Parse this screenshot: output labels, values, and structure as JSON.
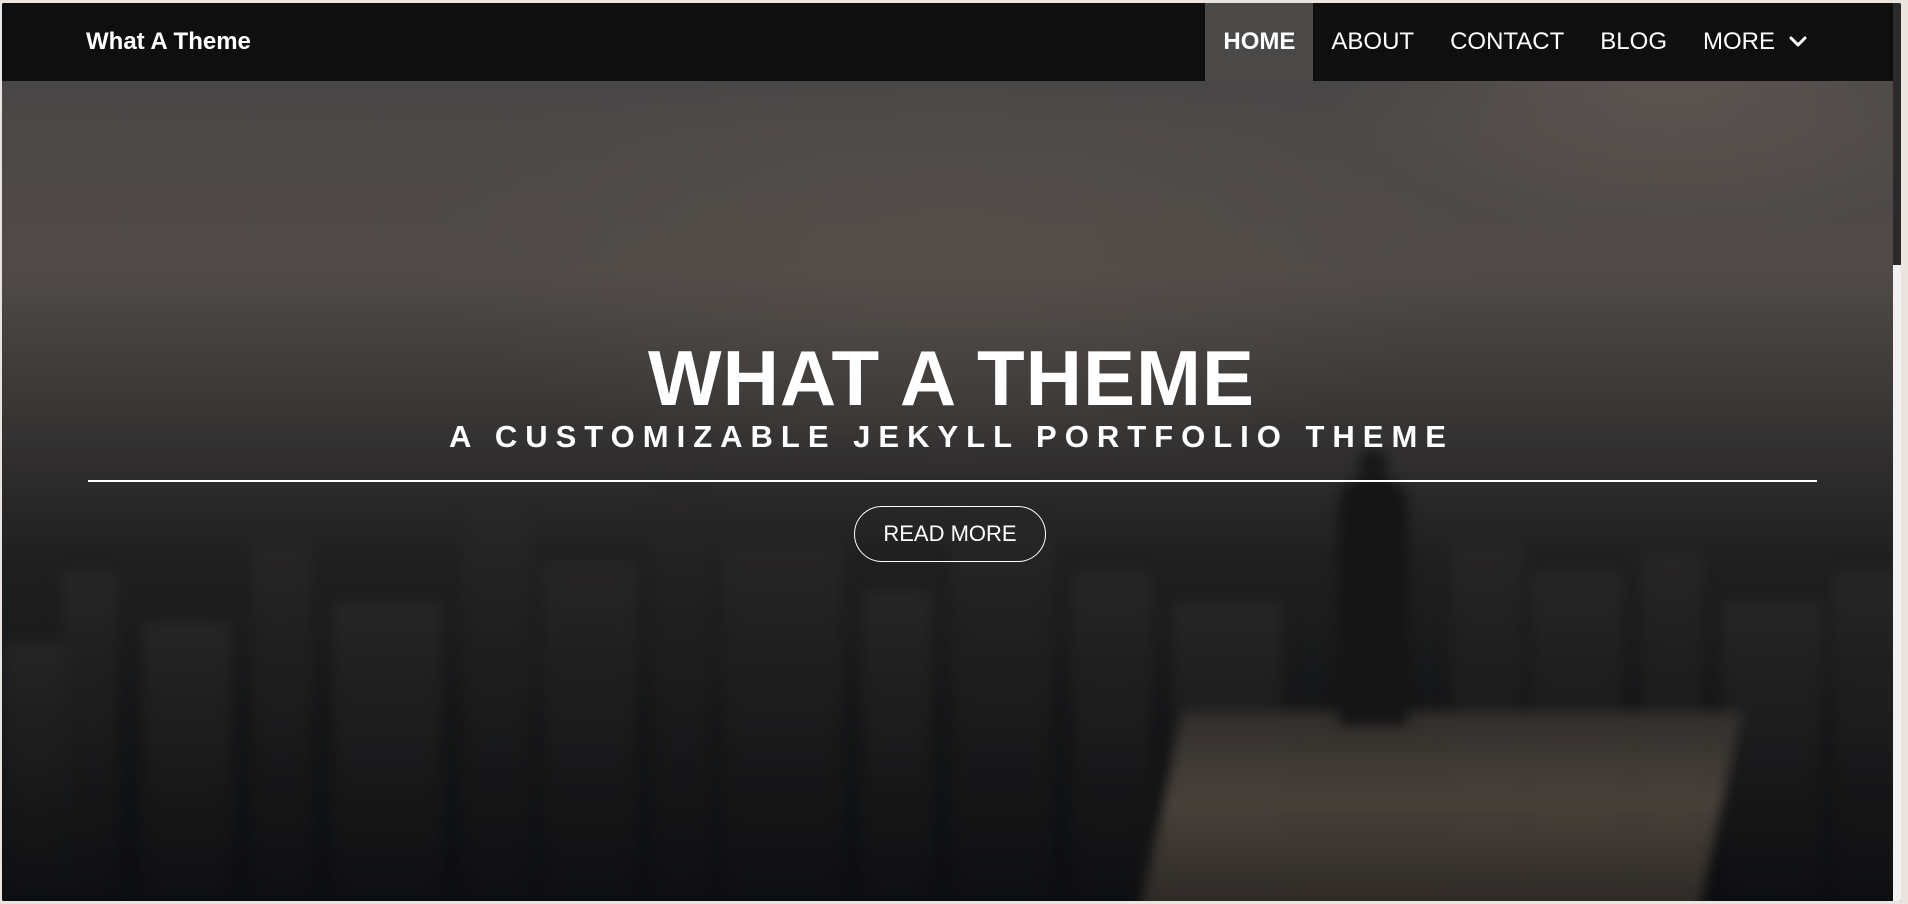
{
  "navbar": {
    "brand": "What A Theme",
    "items": [
      {
        "label": "HOME",
        "active": true
      },
      {
        "label": "ABOUT",
        "active": false
      },
      {
        "label": "CONTACT",
        "active": false
      },
      {
        "label": "BLOG",
        "active": false
      },
      {
        "label": "MORE",
        "active": false,
        "icon": "chevron-down-icon"
      }
    ]
  },
  "hero": {
    "title": "WHAT A THEME",
    "subtitle": "A CUSTOMIZABLE JEKYLL PORTFOLIO THEME",
    "button_label": "READ MORE"
  },
  "colors": {
    "navbar_bg": "#0f0f0f",
    "active_nav_bg": "#4a4948",
    "text": "#ffffff"
  }
}
